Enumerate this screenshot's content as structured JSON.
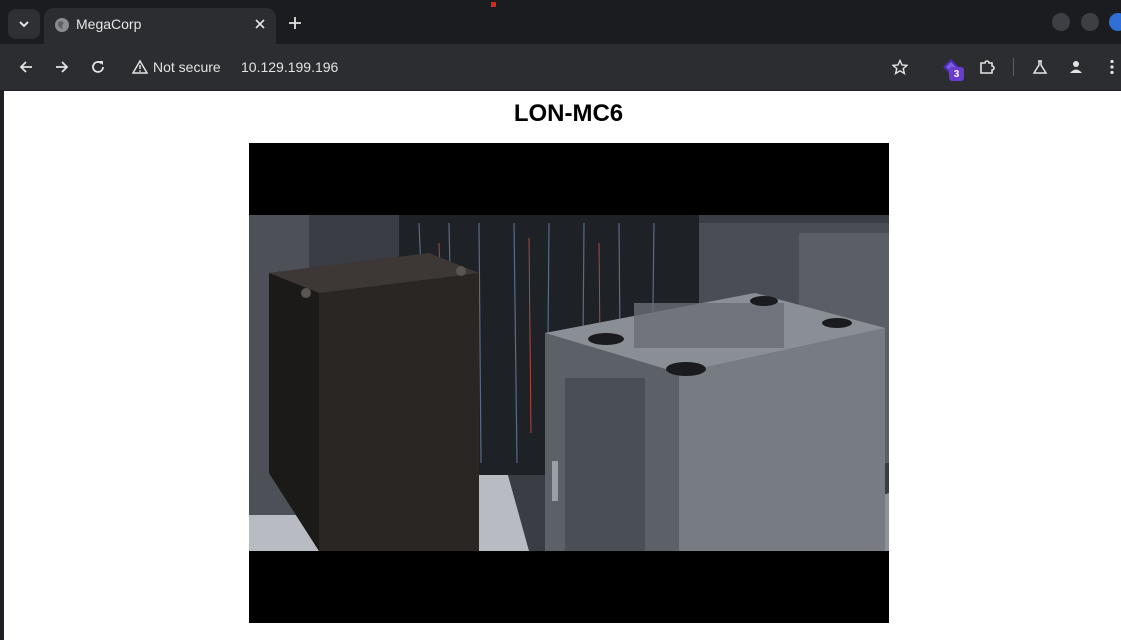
{
  "browser": {
    "tab": {
      "title": "MegaCorp",
      "favicon": "globe-icon",
      "close_icon": "close-icon"
    },
    "new_tab_icon": "plus-icon",
    "tab_search_icon": "chevron-down-icon",
    "nav": {
      "back_icon": "arrow-left-icon",
      "forward_icon": "arrow-right-icon",
      "reload_icon": "reload-icon"
    },
    "address_bar": {
      "security_label": "Not secure",
      "security_icon": "warning-triangle-icon",
      "url": "10.129.199.196",
      "bookmark_icon": "star-icon"
    },
    "extensions": {
      "badge_count": "3",
      "badge_color": "#6a3bcf"
    },
    "icons_right": [
      "puzzle-icon",
      "flask-icon",
      "profile-icon",
      "kebab-menu-icon"
    ]
  },
  "page": {
    "heading": "LON-MC6",
    "video": {
      "description_icon": "camera-feed",
      "letterbox_color": "#000000"
    }
  },
  "colors": {
    "tabstrip_bg": "#1b1c1f",
    "toolbar_bg": "#2b2d31",
    "page_bg": "#ffffff"
  }
}
